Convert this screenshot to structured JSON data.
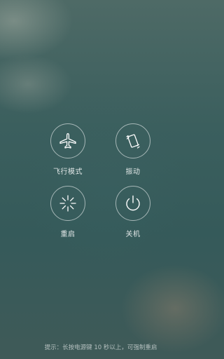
{
  "actions": {
    "airplane_mode": {
      "label": "飞行模式",
      "icon": "airplane-icon"
    },
    "vibrate": {
      "label": "振动",
      "icon": "vibrate-icon"
    },
    "reboot": {
      "label": "重启",
      "icon": "reboot-icon"
    },
    "power_off": {
      "label": "关机",
      "icon": "power-icon"
    }
  },
  "hint": "提示：长按电源键 10 秒以上，可强制重启",
  "colors": {
    "icon_stroke": "#ffffff",
    "ring": "rgba(255,255,255,0.55)"
  }
}
